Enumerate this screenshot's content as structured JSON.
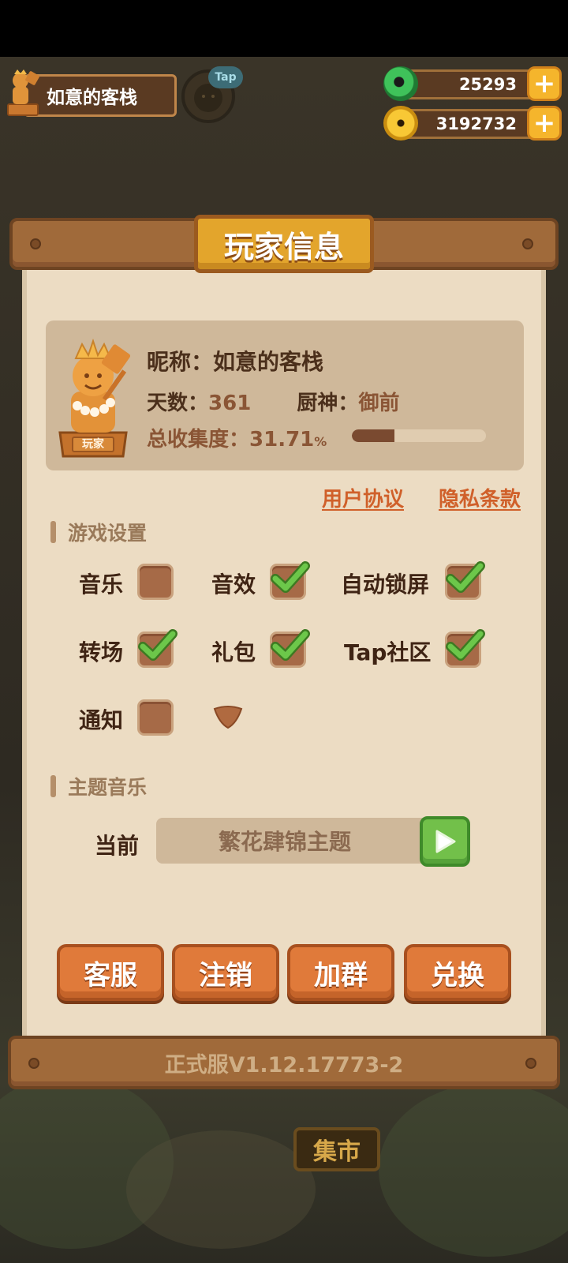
{
  "hud": {
    "inn_name": "如意的客栈",
    "tap_badge": "Tap",
    "jade_amount": "25293",
    "coin_amount": "3192732",
    "plus_symbol": "+"
  },
  "panel": {
    "title": "玩家信息",
    "version": "正式服V1.12.17773-2"
  },
  "player": {
    "nickname_label": "昵称：",
    "nickname": "如意的客栈",
    "days_label": "天数：",
    "days": "361",
    "chef_label": "厨神：",
    "chef": "御前",
    "collection_label": "总收集度：",
    "collection": "31.71",
    "collection_unit": "%",
    "collection_fraction": 0.3171,
    "statue_plaque": "玩家"
  },
  "links": {
    "agreement": "用户协议",
    "privacy": "隐私条款"
  },
  "settings": {
    "section_title": "游戏设置",
    "items": [
      {
        "label": "音乐",
        "checked": false
      },
      {
        "label": "音效",
        "checked": true
      },
      {
        "label": "自动锁屏",
        "checked": true
      },
      {
        "label": "转场",
        "checked": true
      },
      {
        "label": "礼包",
        "checked": true
      },
      {
        "label": "Tap社区",
        "checked": true
      },
      {
        "label": "通知",
        "checked": false
      }
    ]
  },
  "theme": {
    "section_title": "主题音乐",
    "current_label": "当前",
    "current_theme": "繁花肆锦主题"
  },
  "buttons": {
    "service": "客服",
    "logout": "注销",
    "join_group": "加群",
    "redeem": "兑换"
  },
  "scene": {
    "market_sign": "集市"
  },
  "colors": {
    "accent_orange": "#e07a3a",
    "check_green": "#5cb83f",
    "panel_bg": "#ecdcc3"
  }
}
